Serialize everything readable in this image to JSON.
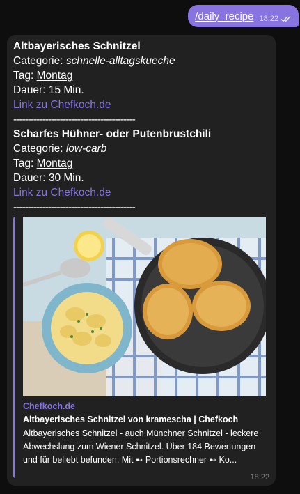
{
  "outgoing": {
    "command": "/daily_recipe",
    "time": "18:22",
    "read_icon": "double-check-icon"
  },
  "message": {
    "recipes": [
      {
        "title": "Altbayerisches Schnitzel",
        "category_label": "Categorie: ",
        "category_value": "schnelle-alltagskueche",
        "day_label": "Tag: ",
        "day_value": "Montag",
        "duration": "Dauer: 15 Min.",
        "link": "Link zu Chefkoch.de",
        "separator": "------------------------------------------"
      },
      {
        "title": "Scharfes Hühner- oder Putenbrustchili",
        "category_label": "Categorie: ",
        "category_value": "low-carb",
        "day_label": "Tag: ",
        "day_value": "Montag",
        "duration": "Dauer: 30 Min.",
        "link": "Link zu Chefkoch.de",
        "separator": "------------------------------------------"
      }
    ],
    "preview": {
      "site": "Chefkoch.de",
      "title": "Altbayerisches Schnitzel von kramescha | Chefkoch",
      "description": "Altbayerisches Schnitzel - auch Münchner Schnitzel - leckere Abwechslung zum Wiener Schnitzel. Über 184 Bewertungen und für beliebt befunden. Mit ➸ Portionsrechner ➸ Ko..."
    },
    "time": "18:22"
  },
  "colors": {
    "accent": "#8774e1",
    "bubble_in": "#212121",
    "background": "#0e0e0e"
  }
}
